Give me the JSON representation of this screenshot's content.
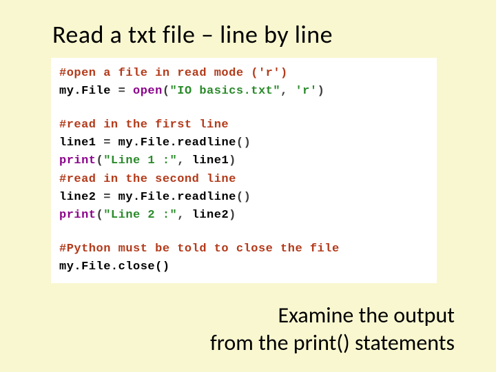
{
  "heading": "Read a txt file – line by line",
  "code": {
    "c1": "#open a file in read mode ('r')",
    "l2_lhs": "my.File",
    "l2_eq": " = ",
    "l2_func": "open",
    "l2_lpar": "(",
    "l2_arg1": "\"IO basics.txt\"",
    "l2_comma": ", ",
    "l2_arg2": "'r'",
    "l2_rpar": ")",
    "c3": "#read in the first line",
    "l4_lhs": "line1",
    "l4_eq": " = ",
    "l4_call": "my.File.readline",
    "l4_lpar": "(",
    "l4_rpar": ")",
    "l5_func": "print",
    "l5_lpar": "(",
    "l5_arg1": "\"Line 1 :\"",
    "l5_comma": ", ",
    "l5_arg2": "line1",
    "l5_rpar": ")",
    "c6": "#read in the second line",
    "l7_lhs": "line2",
    "l7_eq": " = ",
    "l7_call": "my.File.readline",
    "l7_lpar": "(",
    "l7_rpar": ")",
    "l8_func": "print",
    "l8_lpar": "(",
    "l8_arg1": "\"Line 2 :\"",
    "l8_comma": ", ",
    "l8_arg2": "line2",
    "l8_rpar": ")",
    "c9": "#Python must be told to close the file",
    "l10": "my.File.close()"
  },
  "caption": {
    "line1": "Examine the output",
    "line2": "from the print() statements"
  }
}
